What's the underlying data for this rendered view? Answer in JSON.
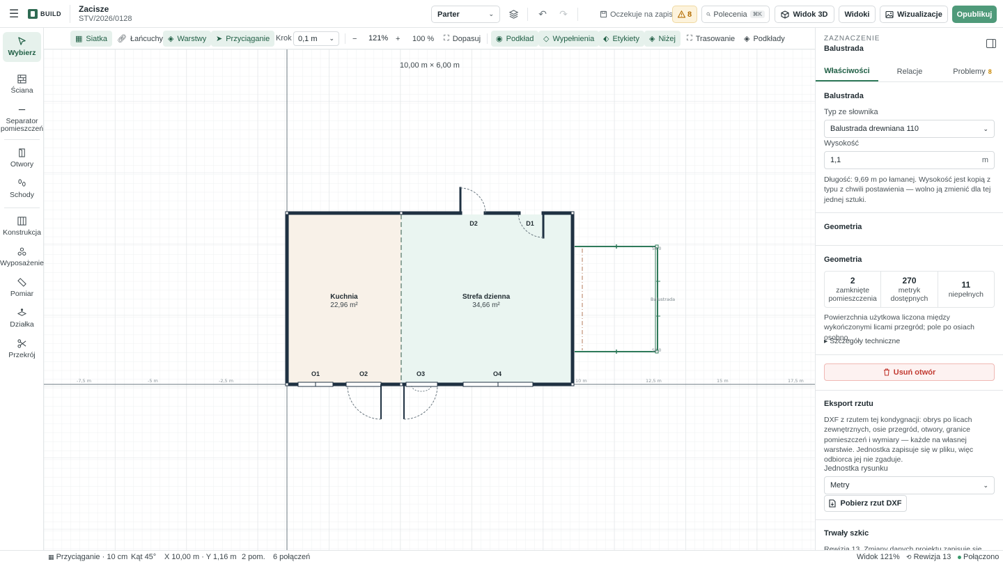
{
  "app": {
    "logo": "BUILD",
    "project_name": "Zacisze",
    "project_code": "STV/2026/0128"
  },
  "topbar": {
    "level": "Parter",
    "save_state": "Oczekuje na zapis",
    "warnings": "8",
    "commands": "Polecenia",
    "commands_kbd": "⌘K",
    "view3d": "Widok 3D",
    "views": "Widoki",
    "visualizations": "Wizualizacje",
    "publish": "Opublikuj"
  },
  "rail": {
    "items": [
      {
        "label": "Wybierz",
        "icon": "cursor-icon"
      },
      {
        "label": "Ściana",
        "icon": "wall-icon"
      },
      {
        "label": "Separator pomieszczeń",
        "icon": "separator-icon"
      },
      {
        "label": "Otwory",
        "icon": "door-icon"
      },
      {
        "label": "Schody",
        "icon": "stairs-icon"
      },
      {
        "label": "Konstrukcja",
        "icon": "structure-icon"
      },
      {
        "label": "Wyposażenie",
        "icon": "furniture-icon"
      },
      {
        "label": "Pomiar",
        "icon": "ruler-icon"
      },
      {
        "label": "Działka",
        "icon": "plot-icon"
      },
      {
        "label": "Przekrój",
        "icon": "scissors-icon"
      }
    ]
  },
  "canvas_toolbar": {
    "grid": "Siatka",
    "chains": "Łańcuchy",
    "layers": "Warstwy",
    "snap": "Przyciąganie",
    "step_label": "Krok",
    "step_value": "0,1 m",
    "zoom": "121%",
    "zoom_reset": "100 %",
    "fit": "Dopasuj",
    "underlay": "Podkład",
    "fills": "Wypełnienia",
    "labels": "Etykiety",
    "lower": "Niżej",
    "tracing": "Trasowanie",
    "underlays": "Podkłady"
  },
  "plan": {
    "dimension": "10,00 m × 6,00 m",
    "rooms": [
      {
        "name": "Kuchnia",
        "area": "22,96 m²"
      },
      {
        "name": "Strefa dzienna",
        "area": "34,66 m²"
      }
    ],
    "openings": [
      "D2",
      "D1",
      "O1",
      "O2",
      "O3",
      "O4"
    ],
    "axis_ticks": [
      "-7,5 m",
      "-5 m",
      "-2,5 m",
      "10 m",
      "12,5 m",
      "15 m",
      "17,5 m"
    ],
    "balcony_label": "Balustrada",
    "balcony_marks": [
      "S0.0",
      "S0.0"
    ]
  },
  "panel": {
    "kicker": "ZAZNACZENIE",
    "selection": "Balustrada",
    "tabs": [
      {
        "label": "Właściwości"
      },
      {
        "label": "Relacje"
      },
      {
        "label": "Problemy",
        "count": "8"
      }
    ],
    "props": {
      "title": "Balustrada",
      "type_label": "Typ ze słownika",
      "type_value": "Balustrada drewniana 110",
      "height_label": "Wysokość",
      "height_value": "1,1",
      "height_unit": "m",
      "note": "Długość: 9,69 m po łamanej. Wysokość jest kopią z typu z chwili postawienia — wolno ją zmienić dla tej jednej sztuki."
    },
    "geometry_title_1": "Geometria",
    "geometry": {
      "title": "Geometria",
      "stats": [
        {
          "value": "2",
          "label": "zamknięte pomieszczenia"
        },
        {
          "value": "270",
          "label": "metryk dostępnych"
        },
        {
          "value": "11",
          "label": "niepełnych"
        }
      ],
      "note": "Powierzchnia użytkowa liczona między wykończonymi licami przegród; pole po osiach osobno.",
      "details": "Szczegóły techniczne"
    },
    "delete_button": "Usuń otwór",
    "export": {
      "title": "Eksport rzutu",
      "note": "DXF z rzutem tej kondygnacji: obrys po licach zewnętrznych, osie przegród, otwory, granice pomieszczeń i wymiary — każde na własnej warstwie. Jednostka zapisuje się w pliku, więc odbiorca jej nie zgaduje.",
      "unit_label": "Jednostka rysunku",
      "unit_value": "Metry",
      "download": "Pobierz rzut DXF"
    },
    "draft": {
      "title": "Trwały szkic",
      "note": "Rewizja 13. Zmiany danych projektu zapisuje się"
    }
  },
  "statusbar": {
    "snap": "Przyciąganie · 10 cm",
    "angle": "Kąt 45°",
    "coords": "X 10,00 m · Y 1,16 m",
    "rooms": "2 pom.",
    "links": "6 połączeń",
    "zoom": "Widok 121%",
    "revision": "Rewizja 13",
    "connection": "Połączono"
  },
  "colors": {
    "accent": "#4f9a7a",
    "wall": "#1f3142",
    "kitchen_fill": "#f8f1e8",
    "living_fill": "#eaf5f1",
    "warning": "#b36b00",
    "danger": "#c23b32"
  }
}
